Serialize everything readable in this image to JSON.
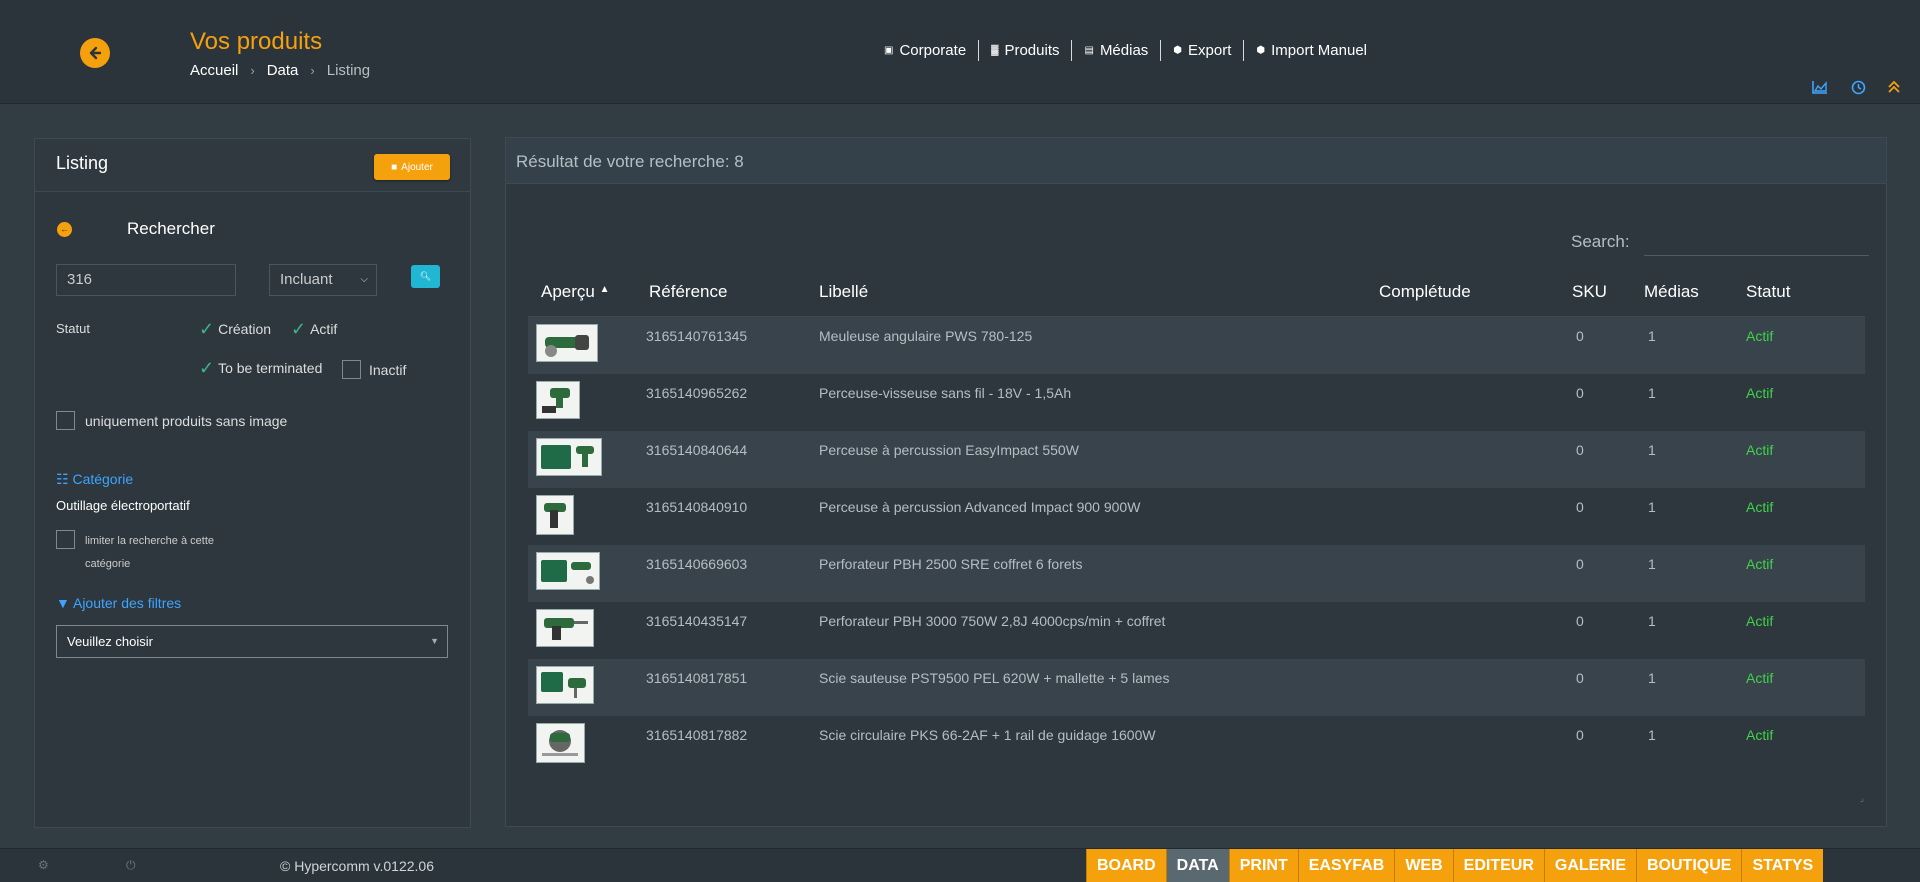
{
  "header": {
    "title": "Vos produits",
    "breadcrumb": [
      "Accueil",
      "Data",
      "Listing"
    ],
    "nav": [
      {
        "icon": "building-icon",
        "label": "Corporate"
      },
      {
        "icon": "chart-icon",
        "label": "Produits"
      },
      {
        "icon": "image-icon",
        "label": "Médias"
      },
      {
        "icon": "box-icon",
        "label": "Export"
      },
      {
        "icon": "box-icon",
        "label": "Import Manuel"
      }
    ]
  },
  "left": {
    "title": "Listing",
    "add_label": "Ajouter",
    "search_label": "Rechercher",
    "search_value": "316",
    "match_mode": "Incluant",
    "statut_label": "Statut",
    "statuses": [
      {
        "label": "Création",
        "checked": true
      },
      {
        "label": "Actif",
        "checked": true
      },
      {
        "label": "To be terminated",
        "checked": true
      },
      {
        "label": "Inactif",
        "checked": false
      }
    ],
    "no_image_label": "uniquement produits sans image",
    "category_title": "Catégorie",
    "category_value": "Outillage électroportatif",
    "limit_label": "limiter la recherche à cette catégorie",
    "filters_title": "Ajouter des filtres",
    "filters_placeholder": "Veuillez choisir"
  },
  "results": {
    "summary": "Résultat de votre recherche: 8",
    "search_label": "Search:",
    "columns": [
      "Aperçu",
      "Référence",
      "Libellé",
      "Complétude",
      "SKU",
      "Médias",
      "Statut"
    ],
    "rows": [
      {
        "ref": "3165140761345",
        "label": "Meuleuse angulaire PWS 780-125",
        "sku": "0",
        "media": "1",
        "status": "Actif"
      },
      {
        "ref": "3165140965262",
        "label": "Perceuse-visseuse sans fil - 18V - 1,5Ah",
        "sku": "0",
        "media": "1",
        "status": "Actif"
      },
      {
        "ref": "3165140840644",
        "label": "Perceuse à percussion EasyImpact 550W",
        "sku": "0",
        "media": "1",
        "status": "Actif"
      },
      {
        "ref": "3165140840910",
        "label": "Perceuse à percussion Advanced Impact 900 900W",
        "sku": "0",
        "media": "1",
        "status": "Actif"
      },
      {
        "ref": "3165140669603",
        "label": "Perforateur PBH 2500 SRE coffret 6 forets",
        "sku": "0",
        "media": "1",
        "status": "Actif"
      },
      {
        "ref": "3165140435147",
        "label": "Perforateur PBH 3000 750W 2,8J 4000cps/min + coffret",
        "sku": "0",
        "media": "1",
        "status": "Actif"
      },
      {
        "ref": "3165140817851",
        "label": "Scie sauteuse PST9500 PEL 620W + mallette + 5 lames",
        "sku": "0",
        "media": "1",
        "status": "Actif"
      },
      {
        "ref": "3165140817882",
        "label": "Scie circulaire PKS 66-2AF + 1 rail de guidage 1600W",
        "sku": "0",
        "media": "1",
        "status": "Actif"
      }
    ]
  },
  "footer": {
    "copyright": "© Hypercomm v.0122.06",
    "apps": [
      "BOARD",
      "DATA",
      "PRINT",
      "EASYFAB",
      "WEB",
      "EDITEUR",
      "GALERIE",
      "BOUTIQUE",
      "STATYS"
    ],
    "active_app": "DATA"
  },
  "colors": {
    "accent": "#f5a10e",
    "link": "#3fa4ff",
    "active_status": "#3fd24a",
    "background": "#323c43"
  }
}
